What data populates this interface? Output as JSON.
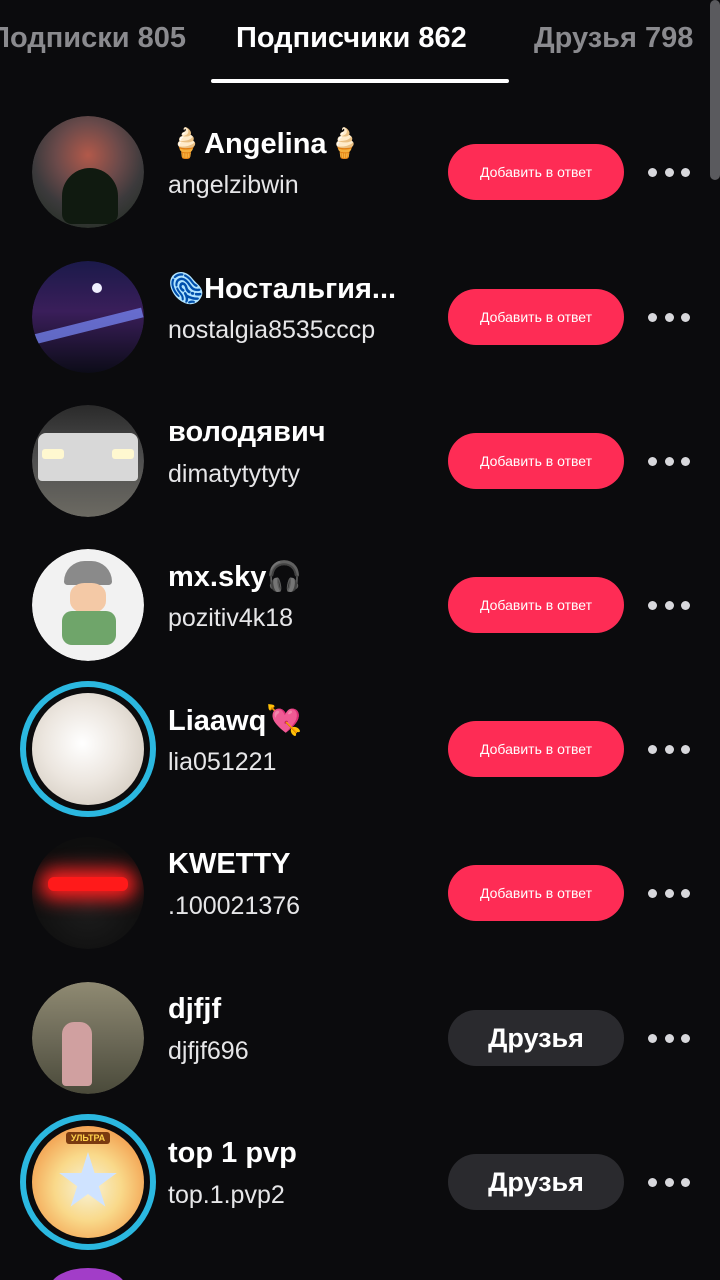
{
  "tabs": [
    {
      "label": "Подписки 805",
      "active": false
    },
    {
      "label": "Подписчики 862",
      "active": true
    },
    {
      "label": "Друзья 798",
      "active": false
    }
  ],
  "colors": {
    "accent": "#fe2c55",
    "ring": "#2bb8e0",
    "background": "#0b0b0d",
    "secondary_button": "#2a2a2e"
  },
  "rows": [
    {
      "name": "🍦Angelina🍦",
      "username": "angelzibwin",
      "button": "Добавить в ответ",
      "button_kind": "add"
    },
    {
      "name": "🫆Ностальгия...",
      "username": "nostalgia8535cccp",
      "button": "Добавить в ответ",
      "button_kind": "add"
    },
    {
      "name": "володявич",
      "username": "dimatytytyty",
      "button": "Добавить в ответ",
      "button_kind": "add"
    },
    {
      "name": "mx.sky🎧",
      "username": "pozitiv4k18",
      "button": "Добавить в ответ",
      "button_kind": "add"
    },
    {
      "name": "Liaawq💘",
      "username": "lia051221",
      "button": "Добавить в ответ",
      "button_kind": "add",
      "story_ring": true
    },
    {
      "name": "KWETTY",
      "username": ".100021376",
      "button": "Добавить в ответ",
      "button_kind": "add"
    },
    {
      "name": "djfjf",
      "username": "djfjf696",
      "button": "Друзья",
      "button_kind": "friends"
    },
    {
      "name": "top 1 pvp",
      "username": "top.1.pvp2",
      "button": "Друзья",
      "button_kind": "friends",
      "story_ring": true,
      "avatar_tag": "УЛЬТРА"
    }
  ]
}
